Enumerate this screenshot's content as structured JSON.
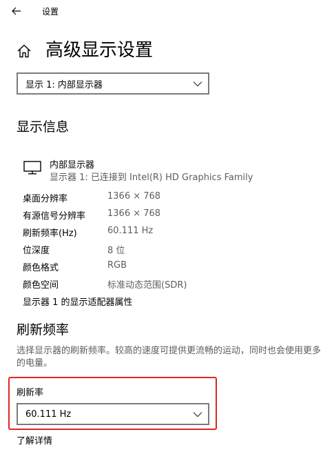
{
  "app": {
    "title": "设置"
  },
  "header": {
    "title": "高级显示设置"
  },
  "display_select": {
    "value": "显示 1: 内部显示器"
  },
  "display_info": {
    "heading": "显示信息",
    "monitor_name": "内部显示器",
    "monitor_sub": "显示器 1: 已连接到 Intel(R) HD Graphics Family",
    "rows": [
      {
        "label": "桌面分辨率",
        "value": "1366 × 768"
      },
      {
        "label": "有源信号分辨率",
        "value": "1366 × 768"
      },
      {
        "label": "刷新频率(Hz)",
        "value": "60.111 Hz"
      },
      {
        "label": "位深度",
        "value": "8 位"
      },
      {
        "label": "颜色格式",
        "value": "RGB"
      },
      {
        "label": "颜色空间",
        "value": "标准动态范围(SDR)"
      }
    ],
    "adapter_link": "显示器 1 的显示适配器属性"
  },
  "refresh": {
    "heading": "刷新频率",
    "description": "选择显示器的刷新频率。较高的速度可提供更流畅的运动，同时也会使用更多的电量。",
    "rate_label": "刷新率",
    "rate_value": "60.111 Hz",
    "learn_more": "了解详情"
  },
  "colors": {
    "highlight": "#e0241f",
    "secondary_text": "#5d5d5d",
    "border": "#7a7a7a"
  },
  "icons": {
    "back": "back-arrow-icon",
    "home": "home-icon",
    "monitor": "monitor-icon",
    "chevron": "chevron-down-icon"
  }
}
